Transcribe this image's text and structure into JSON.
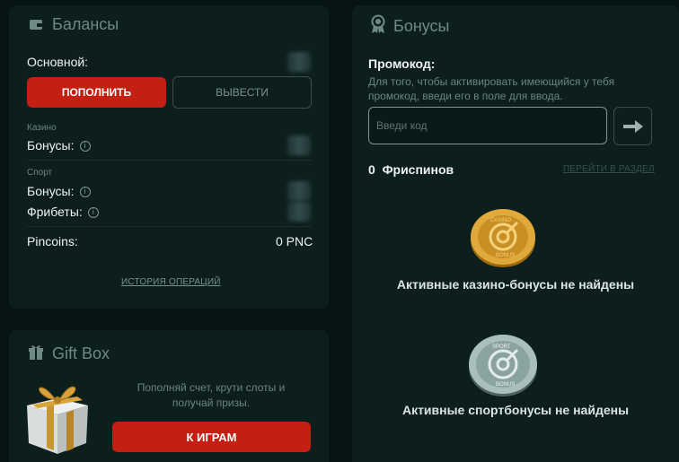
{
  "balances": {
    "title": "Балансы",
    "main_label": "Основной:",
    "deposit_button": "ПОПОЛНИТЬ",
    "withdraw_button": "ВЫВЕСТИ",
    "casino_section": "Казино",
    "casino_bonus_label": "Бонусы:",
    "sport_section": "Спорт",
    "sport_bonus_label": "Бонусы:",
    "freebets_label": "Фрибеты:",
    "pincoins_label": "Pincoins:",
    "pincoins_value": "0 PNC",
    "history_link": "ИСТОРИЯ ОПЕРАЦИЙ",
    "info_glyph": "i"
  },
  "giftbox": {
    "title": "Gift Box",
    "description": "Пополняй счет, крути слоты и получай призы.",
    "play_button": "К ИГРАМ"
  },
  "bonuses": {
    "title": "Бонусы",
    "promo_label": "Промокод:",
    "promo_hint": "Для того, чтобы активировать имеющийся у тебя промокод, введи его в поле для ввода.",
    "promo_placeholder": "Введи код",
    "freespins_count": "0",
    "freespins_label": "Фриспинов",
    "goto_section_link": "ПЕРЕЙТИ В РАЗДЕЛ",
    "casino_coin_text": "CASINO",
    "casino_coin_sub": "BONUS",
    "casino_empty": "Активные казино-бонусы не найдены",
    "sport_coin_text": "SPORT",
    "sport_coin_sub": "BONUS",
    "sport_empty": "Активные спортбонусы не найдены"
  },
  "colors": {
    "background": "#061514",
    "panel": "#0c1f1d",
    "accent_red": "#c31f12",
    "muted": "#6f8a86"
  }
}
